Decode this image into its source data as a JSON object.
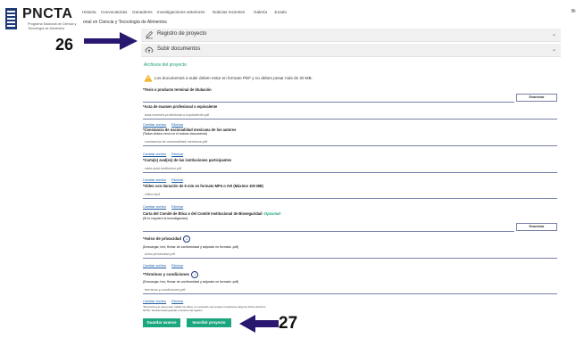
{
  "header": {
    "brand": "PNCTA",
    "brand_subtitle": "Programa Nacional de Ciencia y Tecnología de Alimentos",
    "nav": [
      "Historia",
      "Convocatorias",
      "Ganadores",
      "Investigaciones anteriores",
      "Noticias recientes",
      "Galería",
      "Jurado"
    ],
    "nav_right": "Bi",
    "program_line": "onal en Ciencia y Tecnología de Alimentos"
  },
  "callouts": {
    "top": "26",
    "bottom": "27"
  },
  "accordion": {
    "register": "Registro de proyecto",
    "upload": "Subir documentos"
  },
  "section_title": "Archivos del proyecto",
  "warning": "Los documentos a subir deben estar en formato PDF y no deben pesar más de 30 MB.",
  "browse_label": "Examinar",
  "link_change": "Cambiar archivo",
  "link_delete": "Eliminar",
  "fields": {
    "thesis": {
      "label": "*Tesis o producto terminal de titulación"
    },
    "exam": {
      "label": "*Acta de examen profesional o equivalente",
      "value": "acta-examen-profesional-o-equivalente.pdf"
    },
    "nationality": {
      "label": "*Constancia de nacionalidad mexicana de los autores",
      "sub": "(Todos deben venir en el mismo documento)",
      "value": "constancia-de-nacionalidad-mexicana.pdf"
    },
    "institution": {
      "label": "*Carta(s) aval(es) de las instituciones participantes",
      "value": "carta-aval-institucion.pdf"
    },
    "video": {
      "label": "*Video con duración de 5 min en formato MP4 o AVI (Máximo 100 MB)",
      "value": "video.mp4"
    },
    "ethics": {
      "label": "Carta del Comité de Ética o del Comité Institucional de Bioseguridad",
      "optional": "-Opcional-",
      "sub": "(Si lo requiere la investigación)"
    },
    "privacy": {
      "label": "*Aviso de privacidad",
      "sub": "(Descargar, leer, firmar de conformidad y adjuntar en formato .pdf)",
      "value": "aviso-privacidad.pdf"
    },
    "terms": {
      "label": "*Términos y condiciones",
      "sub": "(Descargar, leer, firmar de conformidad y adjuntar en formato .pdf)",
      "value": "terminos-y-condiciones.pdf"
    }
  },
  "footnotes": {
    "line1": "*Recuerda que para poder validar tus datos, es necesario que tengas completa la carga de dichos archivos",
    "line2": "NOTA: Tendrás hasta guardar el avance del registro"
  },
  "buttons": {
    "save": "Guardar avance",
    "submit": "Inscribir proyecto"
  },
  "colors": {
    "accent": "#1aa67e",
    "brand": "#1e3b78"
  }
}
